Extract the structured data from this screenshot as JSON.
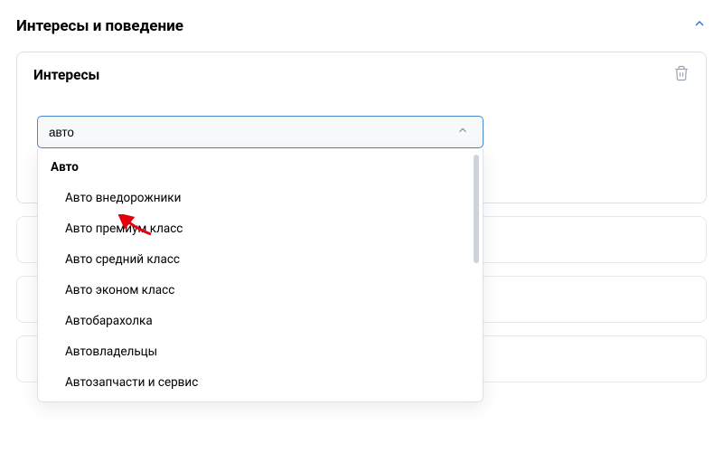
{
  "section": {
    "title": "Интересы и поведение"
  },
  "interests_card": {
    "title": "Интересы"
  },
  "search": {
    "value": "авто"
  },
  "dropdown": {
    "group_label": "Авто",
    "items": [
      "Авто внедорожники",
      "Авто премиум класс",
      "Авто средний класс",
      "Авто эконом класс",
      "Автобарахолка",
      "Автовладельцы",
      "Автозапчасти и сервис"
    ]
  }
}
